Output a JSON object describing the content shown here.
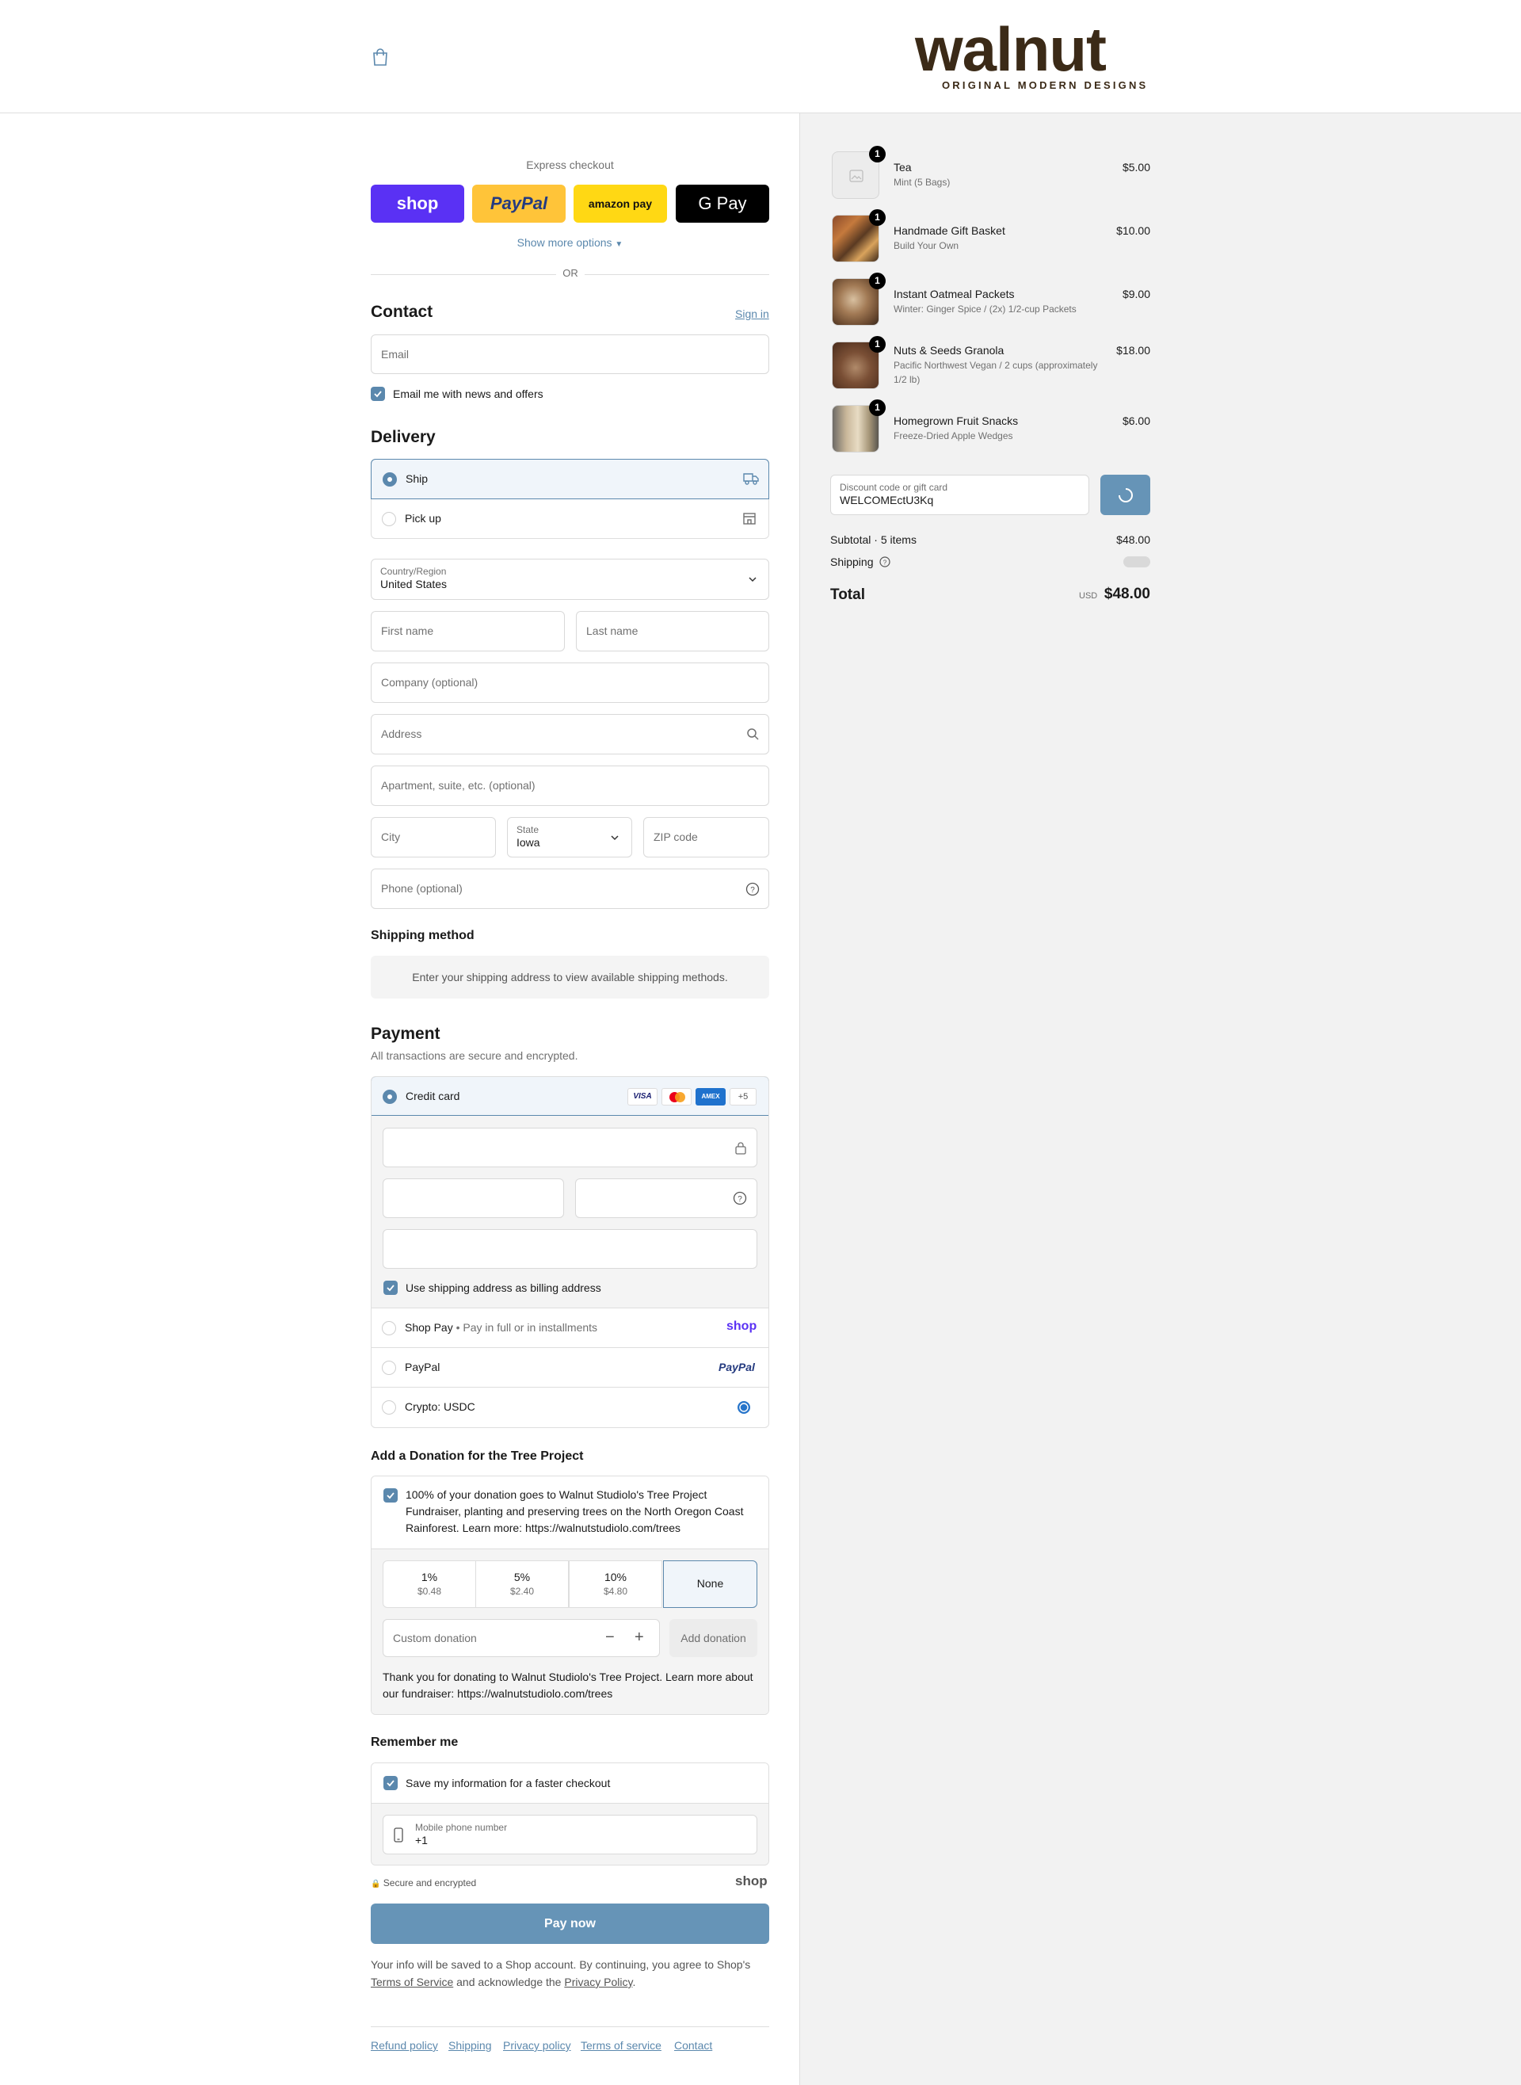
{
  "store": {
    "name": "walnut",
    "tagline": "ORIGINAL MODERN DESIGNS"
  },
  "express": {
    "title": "Express checkout",
    "buttons": [
      {
        "name": "shop",
        "label": "shop",
        "bg": "#5a31f4"
      },
      {
        "name": "paypal",
        "label": "PayPal",
        "bg": "#ffc439"
      },
      {
        "name": "amazon-pay",
        "label": "amazon pay",
        "bg": "#ffd814"
      },
      {
        "name": "google-pay",
        "label": "G Pay",
        "bg": "#000000"
      }
    ],
    "more": "Show more options",
    "or": "OR"
  },
  "contact": {
    "title": "Contact",
    "sign_in": "Sign in",
    "email_placeholder": "Email",
    "news_label": "Email me with news and offers"
  },
  "delivery": {
    "title": "Delivery",
    "options": [
      {
        "label": "Ship",
        "selected": true
      },
      {
        "label": "Pick up",
        "selected": false
      }
    ],
    "country_label": "Country/Region",
    "country_value": "United States",
    "first_name": "First name",
    "last_name": "Last name",
    "company": "Company (optional)",
    "address": "Address",
    "apartment": "Apartment, suite, etc. (optional)",
    "city": "City",
    "state_label": "State",
    "state_value": "Iowa",
    "zip": "ZIP code",
    "phone": "Phone (optional)"
  },
  "shipping_method": {
    "title": "Shipping method",
    "message": "Enter your shipping address to view available shipping methods."
  },
  "payment": {
    "title": "Payment",
    "subtitle": "All transactions are secure and encrypted.",
    "credit_card": "Credit card",
    "card_brands": [
      "VISA",
      "mastercard",
      "AMEX"
    ],
    "more_brands": "+5",
    "billing_label": "Use shipping address as billing address",
    "shop_pay": "Shop Pay",
    "shop_pay_sub": "Pay in full or in installments",
    "shop_pay_logo": "shop",
    "paypal": "PayPal",
    "paypal_logo": "PayPal",
    "crypto": "Crypto: USDC"
  },
  "donation": {
    "title": "Add a Donation for the Tree Project",
    "description": "100% of your donation goes to Walnut Studiolo's Tree Project Fundraiser, planting and preserving trees on the North Oregon Coast Rainforest. Learn more: https://walnutstudiolo.com/trees",
    "options": [
      {
        "pct": "1%",
        "amount": "$0.48"
      },
      {
        "pct": "5%",
        "amount": "$2.40"
      },
      {
        "pct": "10%",
        "amount": "$4.80"
      },
      {
        "pct": "None",
        "amount": ""
      }
    ],
    "custom_placeholder": "Custom donation",
    "minus": "−",
    "plus": "+",
    "add": "Add donation",
    "thanks": "Thank you for donating to Walnut Studiolo's Tree Project. Learn more about our fundraiser: https://walnutstudiolo.com/trees"
  },
  "remember": {
    "title": "Remember me",
    "save_label": "Save my information for a faster checkout",
    "phone_label": "Mobile phone number",
    "phone_value": "+1",
    "secure": "Secure and encrypted",
    "shop_logo": "shop"
  },
  "pay_button": "Pay now",
  "legal": {
    "text1": "Your info will be saved to a Shop account. By continuing, you agree to Shop's",
    "terms": "Terms of Service",
    "and": "and acknowledge the",
    "privacy": "Privacy Policy",
    "period": "."
  },
  "footer_links": [
    "Refund policy",
    "Shipping",
    "Privacy policy",
    "Terms of service",
    "Contact"
  ],
  "summary": {
    "items": [
      {
        "name": "Tea",
        "variant": "Mint (5 Bags)",
        "price": "$5.00",
        "qty": "1"
      },
      {
        "name": "Handmade Gift Basket",
        "variant": "Build Your Own",
        "price": "$10.00",
        "qty": "1"
      },
      {
        "name": "Instant Oatmeal Packets",
        "variant": "Winter: Ginger Spice / (2x) 1/2-cup Packets",
        "price": "$9.00",
        "qty": "1"
      },
      {
        "name": "Nuts & Seeds Granola",
        "variant": "Pacific Northwest Vegan / 2 cups (approximately 1/2 lb)",
        "price": "$18.00",
        "qty": "1"
      },
      {
        "name": "Homegrown Fruit Snacks",
        "variant": "Freeze-Dried Apple Wedges",
        "price": "$6.00",
        "qty": "1"
      }
    ],
    "discount_label": "Discount code or gift card",
    "discount_value": "WELCOMEctU3Kq",
    "subtotal_label": "Subtotal · 5 items",
    "subtotal": "$48.00",
    "shipping_label": "Shipping",
    "total_label": "Total",
    "currency": "USD",
    "total": "$48.00"
  },
  "colors": {
    "accent": "#5b88ad",
    "accent_light": "#f0f5fa",
    "sidebar_bg": "#f2f2f2"
  }
}
